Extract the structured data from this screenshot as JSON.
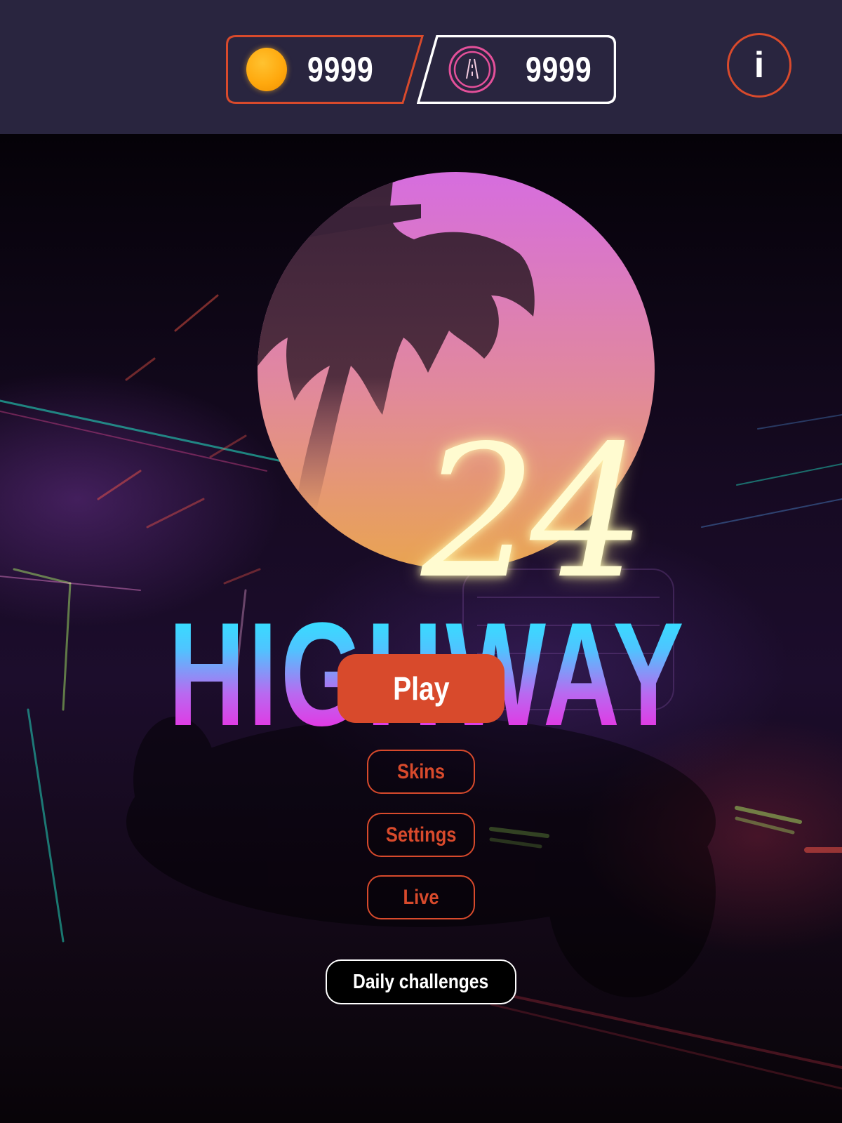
{
  "game": {
    "title": "HIGHWAY",
    "number": "24"
  },
  "hud": {
    "coins": {
      "icon": "coin-icon",
      "value": "9999",
      "color": "#ffa90e"
    },
    "road_tokens": {
      "icon": "road-icon",
      "value": "9999"
    },
    "info_label": "i"
  },
  "menu": {
    "play_label": "Play",
    "skins_label": "Skins",
    "settings_label": "Settings",
    "live_label": "Live",
    "daily_label": "Daily challenges"
  },
  "colors": {
    "accent": "#d84a2c",
    "topbar": "#29253f",
    "title_top": "#2ee6ff",
    "title_bottom": "#ee2be0",
    "sun_top": "#d66ddf",
    "sun_bottom": "#e9a451",
    "number": "#fffbd0"
  }
}
